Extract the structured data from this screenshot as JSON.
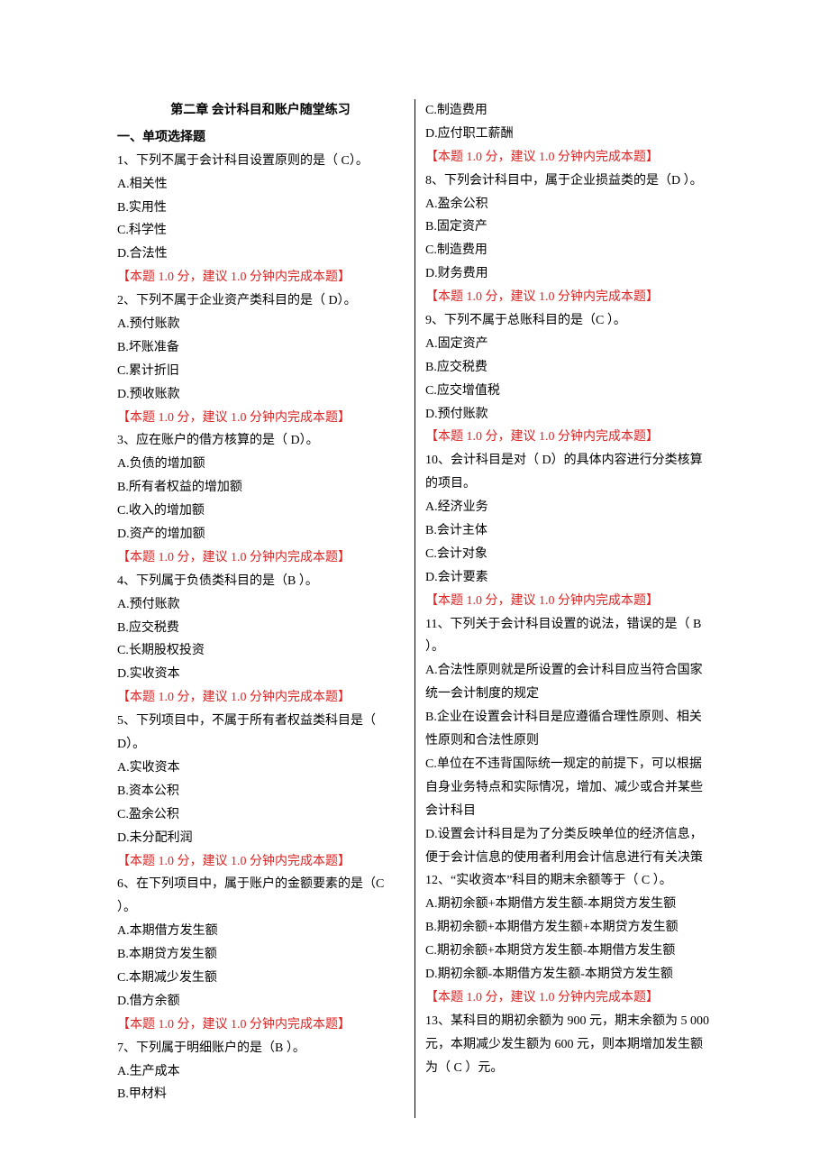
{
  "title": "第二章 会计科目和账户随堂练习",
  "sectionHeading": "一、单项选择题",
  "hintText": "【本题 1.0 分，建议 1.0 分钟内完成本题】",
  "q1": {
    "stem": "1、下列不属于会计科目设置原则的是（  C）。",
    "A": "A.相关性",
    "B": "B.实用性",
    "C": "C.科学性",
    "D": "D.合法性"
  },
  "q2": {
    "stem": "2、下列不属于企业资产类科目的是（  D）。",
    "A": "A.预付账款",
    "B": "B.坏账准备",
    "C": "C.累计折旧",
    "D": "D.预收账款"
  },
  "q3": {
    "stem": "3、应在账户的借方核算的是（  D）。",
    "A": "A.负债的增加额",
    "B": "B.所有者权益的增加额",
    "C": "C.收入的增加额",
    "D": "D.资产的增加额"
  },
  "q4": {
    "stem": "4、下列属于负债类科目的是（B  ）。",
    "A": "A.预付账款",
    "B": "B.应交税费",
    "C": "C.长期股权投资",
    "D": "D.实收资本"
  },
  "q5": {
    "stem": "5、下列项目中，不属于所有者权益类科目是（  D）。",
    "A": "A.实收资本",
    "B": "B.资本公积",
    "C": "C.盈余公积",
    "D": "D.未分配利润"
  },
  "q6": {
    "stem": "6、在下列项目中，属于账户的金额要素的是（C  ）。",
    "A": "A.本期借方发生额",
    "B": "B.本期贷方发生额",
    "C": "C.本期减少发生额",
    "D": "D.借方余额"
  },
  "q7": {
    "stem": "7、下列属于明细账户的是（B  ）。",
    "A": "A.生产成本",
    "B": "B.甲材料",
    "C": "C.制造费用",
    "D": "D.应付职工薪酬"
  },
  "q8": {
    "stem": "8、下列会计科目中，属于企业损益类的是（D  ）。",
    "A": "A.盈余公积",
    "B": "B.固定资产",
    "C": "C.制造费用",
    "D": "D.财务费用"
  },
  "q9": {
    "stem": "9、下列不属于总账科目的是（C  ）。",
    "A": "A.固定资产",
    "B": "B.应交税费",
    "C": "C.应交增值税",
    "D": "D.预付账款"
  },
  "q10": {
    "stem": "10、会计科目是对（  D）的具体内容进行分类核算的项目。",
    "A": "A.经济业务",
    "B": "B.会计主体",
    "C": "C.会计对象",
    "D": "D.会计要素"
  },
  "q11": {
    "stem": "11、下列关于会计科目设置的说法，错误的是（  B  ）。",
    "A": "A.合法性原则就是所设置的会计科目应当符合国家统一会计制度的规定",
    "B": "B.企业在设置会计科目是应遵循合理性原则、相关性原则和合法性原则",
    "C": "C.单位在不违背国际统一规定的前提下，可以根据自身业务特点和实际情况，增加、减少或合并某些会计科目",
    "D": "D.设置会计科目是为了分类反映单位的经济信息，便于会计信息的使用者利用会计信息进行有关决策"
  },
  "q12": {
    "stem": "12、“实收资本”科目的期末余额等于（  C  ）。",
    "A": "A.期初余额+本期借方发生额-本期贷方发生额",
    "B": "B.期初余额+本期借方发生额+本期贷方发生额",
    "C": "C.期初余额+本期贷方发生额-本期借方发生额",
    "D": "D.期初余额-本期借方发生额-本期贷方发生额"
  },
  "q13": {
    "stem": "13、某科目的期初余额为 900 元，期末余额为 5 000 元，本期减少发生额为 600 元，则本期增加发生额为（  C  ）元。"
  }
}
